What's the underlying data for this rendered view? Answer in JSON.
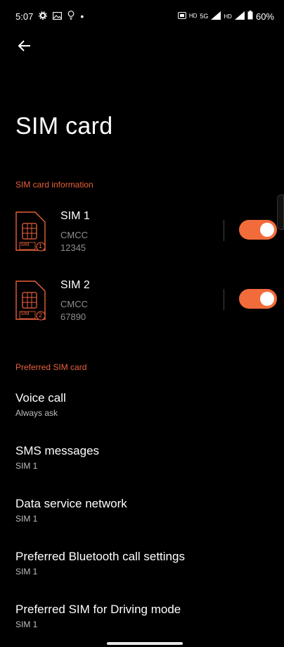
{
  "status_bar": {
    "time": "5:07",
    "battery": "60%",
    "network": "5G"
  },
  "page": {
    "title": "SIM card"
  },
  "sections": {
    "sim_info": "SIM card information",
    "preferred": "Preferred SIM card"
  },
  "sims": [
    {
      "name": "SIM 1",
      "carrier": "CMCC",
      "number": "12345",
      "slot": "1",
      "icon_label": "SIM",
      "enabled": true
    },
    {
      "name": "SIM 2",
      "carrier": "CMCC",
      "number": "67890",
      "slot": "2",
      "icon_label": "SIM",
      "enabled": true
    }
  ],
  "preferences": [
    {
      "title": "Voice call",
      "value": "Always ask"
    },
    {
      "title": "SMS messages",
      "value": "SIM 1"
    },
    {
      "title": "Data service network",
      "value": "SIM 1"
    },
    {
      "title": "Preferred Bluetooth call settings",
      "value": "SIM 1"
    },
    {
      "title": "Preferred SIM for Driving mode",
      "value": "SIM 1"
    }
  ],
  "colors": {
    "accent": "#e8603c",
    "toggle_on": "#f26b3a",
    "background": "#000000"
  },
  "icons": {
    "back": "arrow-left-icon",
    "sim": "sim-card-icon"
  }
}
